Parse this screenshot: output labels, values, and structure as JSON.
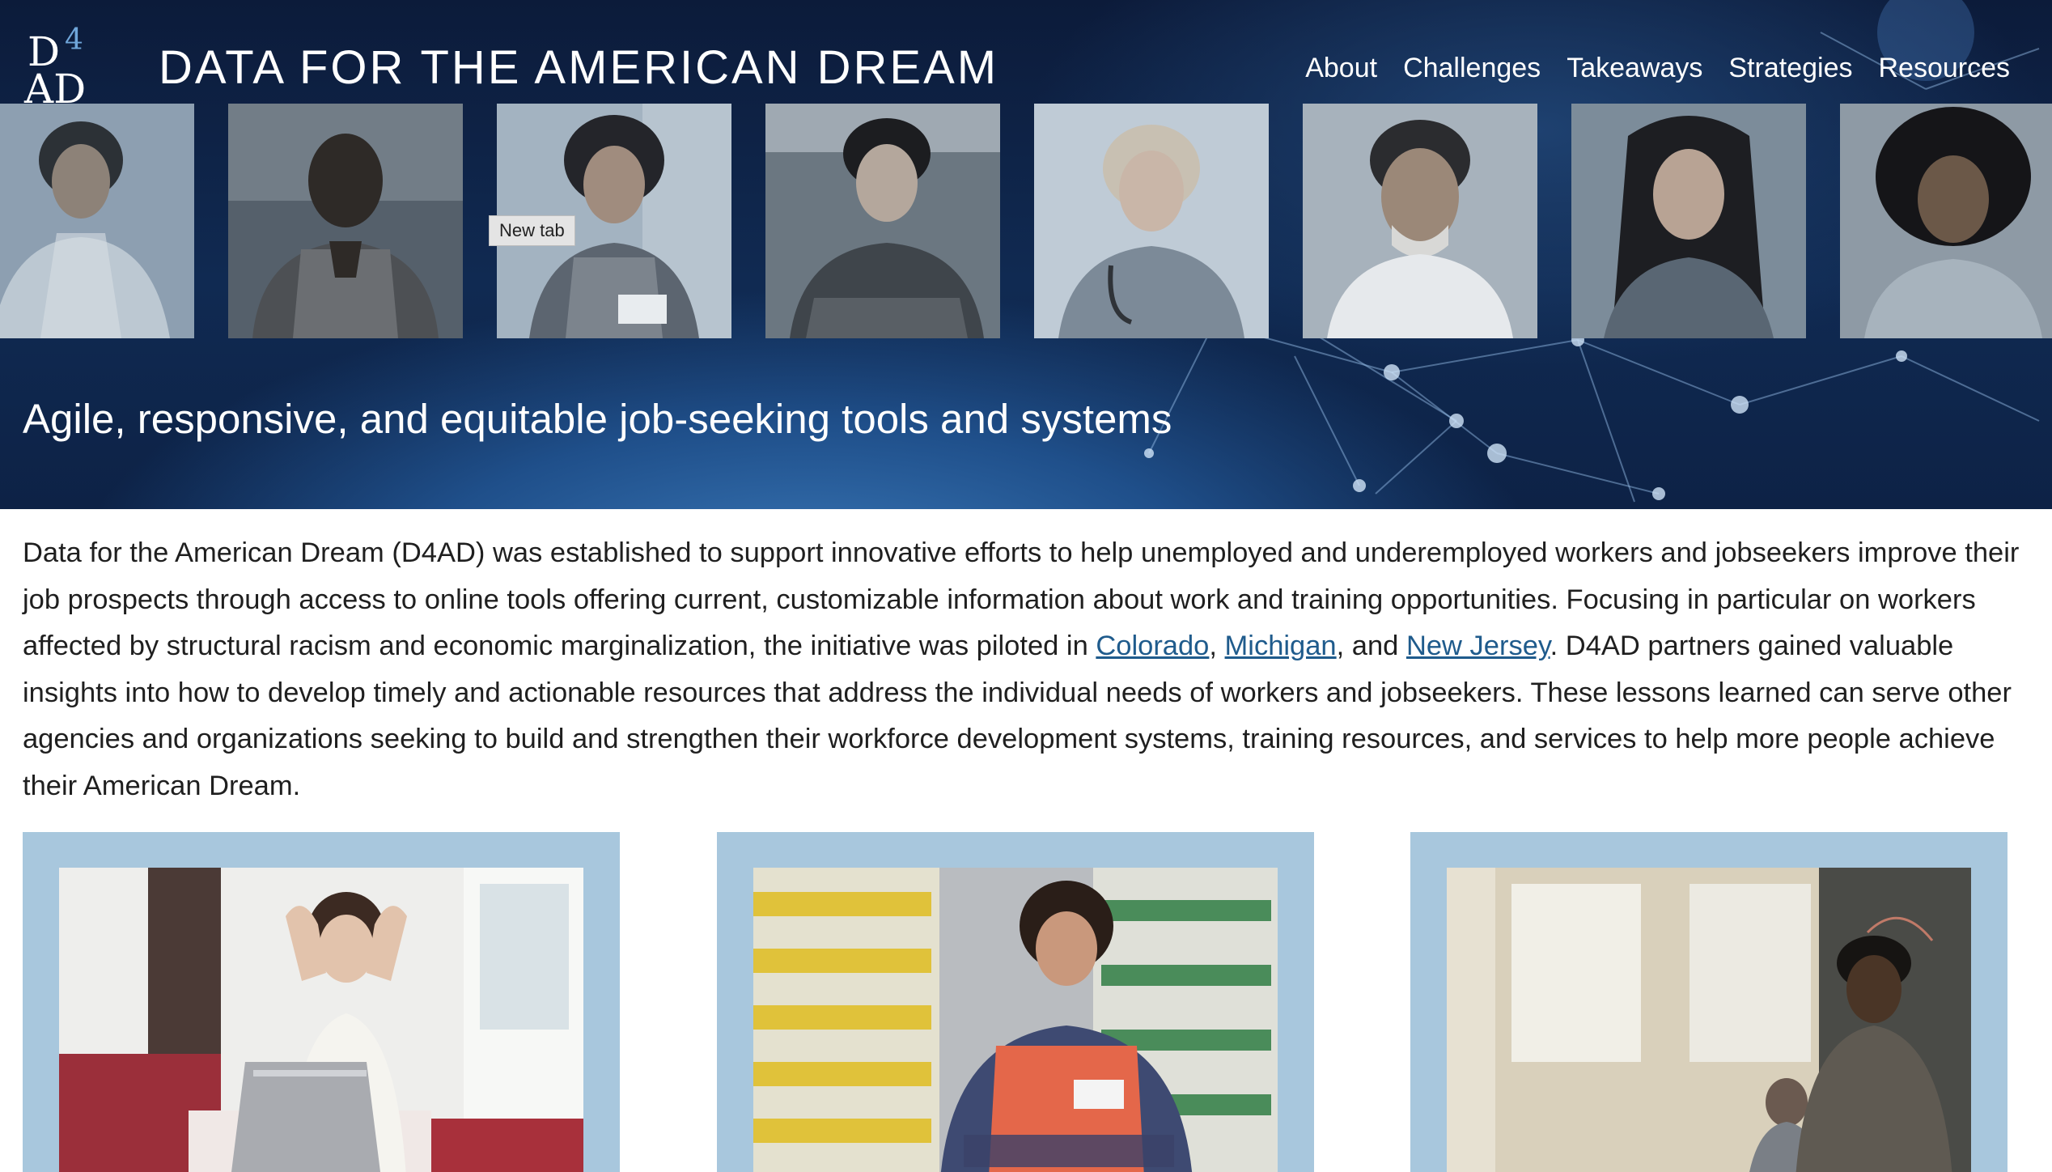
{
  "header": {
    "logo": {
      "line1": "D",
      "accent": "4",
      "line2": "AD"
    },
    "site_title": "DATA FOR THE AMERICAN DREAM",
    "nav": [
      "About",
      "Challenges",
      "Takeaways",
      "Strategies",
      "Resources"
    ]
  },
  "hero": {
    "tooltip": "New tab",
    "tagline": "Agile, responsive, and equitable job-seeking tools and systems"
  },
  "intro": {
    "before": "Data for the American Dream (D4AD) was established to support innovative efforts to help unemployed and underemployed workers and jobseekers improve their job prospects through access to online tools offering current, customizable information about work and training opportunities. Focusing in particular on workers affected by structural racism and economic marginalization, the initiative was piloted in ",
    "links": [
      "Colorado",
      "Michigan",
      "New Jersey"
    ],
    "sep1": ", ",
    "sep2": ", and ",
    "after": ".  D4AD partners gained valuable insights into how to develop timely and actionable resources that address the individual needs of workers and jobseekers.  These lessons learned can serve other agencies and organizations seeking to build and strengthen their workforce development systems, training resources, and services to help more people achieve their American Dream."
  }
}
